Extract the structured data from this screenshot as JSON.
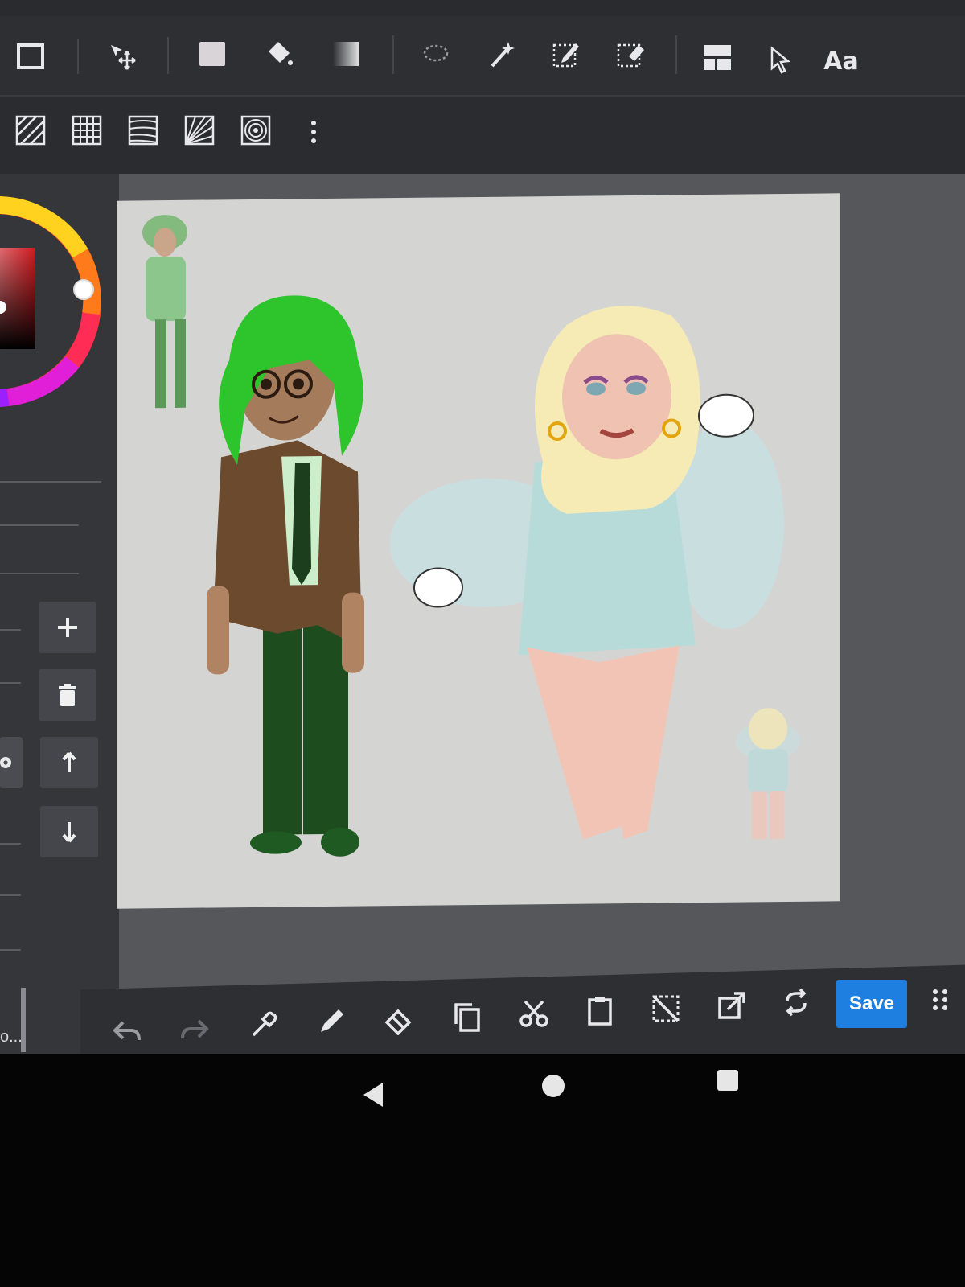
{
  "toolbar_top": {
    "tools": [
      {
        "name": "rectangle-select-icon"
      },
      {
        "name": "move-transform-icon"
      },
      {
        "name": "fill-rect-icon"
      },
      {
        "name": "bucket-fill-icon"
      },
      {
        "name": "gradient-icon"
      },
      {
        "name": "lasso-icon"
      },
      {
        "name": "magic-wand-icon"
      },
      {
        "name": "selection-pen-icon"
      },
      {
        "name": "selection-eraser-icon"
      },
      {
        "name": "frame-divider-icon"
      },
      {
        "name": "pointer-icon"
      }
    ],
    "text_tool_label": "Aa"
  },
  "toolbar_patterns": {
    "tools": [
      {
        "name": "parallel-ruler-icon"
      },
      {
        "name": "grid-ruler-icon"
      },
      {
        "name": "perspective-ruler-icon"
      },
      {
        "name": "radial-ruler-icon"
      },
      {
        "name": "concentric-ruler-icon"
      },
      {
        "name": "more-vertical-icon"
      }
    ]
  },
  "color_picker": {
    "selected_color": "#c8161d"
  },
  "layers_panel": {
    "buttons": [
      {
        "name": "add-layer-button",
        "icon": "plus-icon"
      },
      {
        "name": "delete-layer-button",
        "icon": "trash-icon"
      },
      {
        "name": "move-layer-up-button",
        "icon": "arrow-up-icon"
      },
      {
        "name": "move-layer-down-button",
        "icon": "arrow-down-icon"
      }
    ],
    "layer_name_truncated": "o..."
  },
  "bottom_toolbar": {
    "tools": [
      {
        "name": "undo-icon",
        "enabled": true
      },
      {
        "name": "redo-icon",
        "enabled": false
      },
      {
        "name": "eyedropper-icon",
        "enabled": true
      },
      {
        "name": "pen-icon",
        "enabled": true
      },
      {
        "name": "eraser-icon",
        "enabled": true
      },
      {
        "name": "copy-icon",
        "enabled": true
      },
      {
        "name": "cut-icon",
        "enabled": true
      },
      {
        "name": "paste-icon",
        "enabled": true
      },
      {
        "name": "deselect-icon",
        "enabled": true
      },
      {
        "name": "export-icon",
        "enabled": true
      },
      {
        "name": "sync-icon",
        "enabled": true
      }
    ],
    "save_label": "Save"
  },
  "colors": {
    "accent": "#1e7fe0",
    "toolbar_bg": "#2e2f33",
    "canvas_bg": "#d4d5d3"
  }
}
